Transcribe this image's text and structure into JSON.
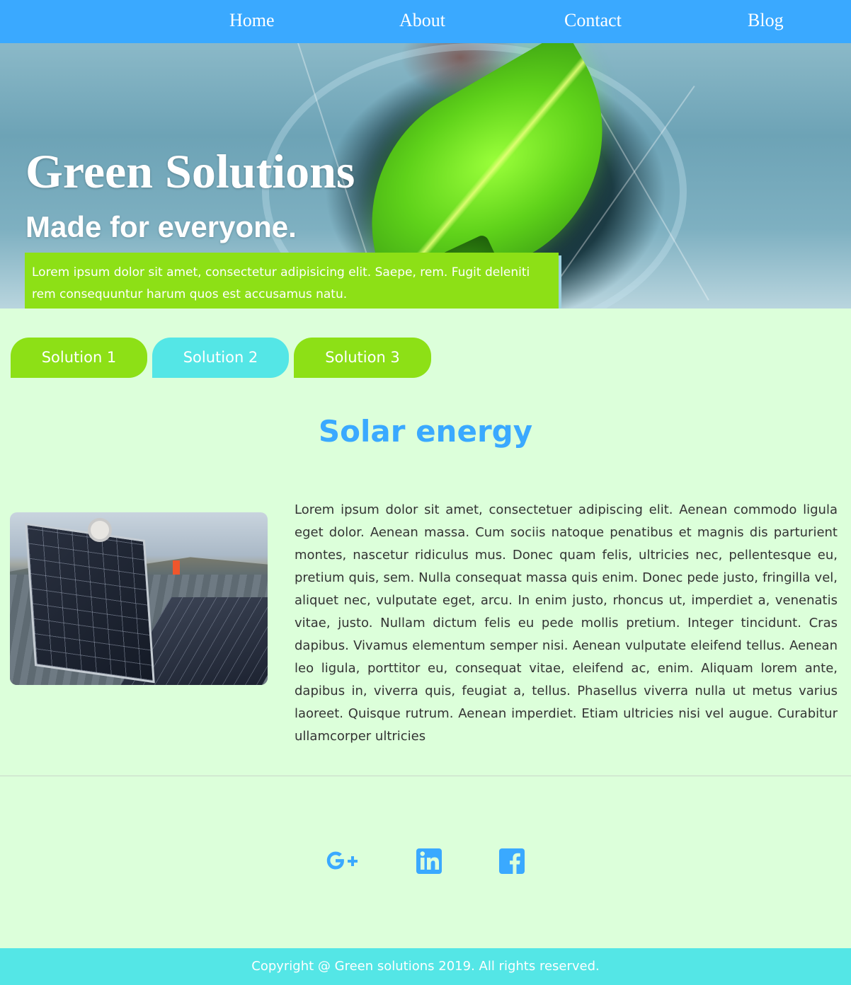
{
  "nav": {
    "items": [
      {
        "label": "Home"
      },
      {
        "label": "About"
      },
      {
        "label": "Contact"
      },
      {
        "label": "Blog"
      }
    ]
  },
  "hero": {
    "title": "Green Solutions",
    "subtitle": "Made for everyone.",
    "blurb": "Lorem ipsum dolor sit amet, consectetur adipisicing elit. Saepe, rem. Fugit deleniti rem consequuntur harum quos est accusamus natu."
  },
  "tabs": [
    {
      "label": "Solution 1",
      "color": "#8de016"
    },
    {
      "label": "Solution 2",
      "color": "#54e6e6"
    },
    {
      "label": "Solution 3",
      "color": "#8de016"
    }
  ],
  "section": {
    "title": "Solar energy",
    "body": "Lorem ipsum dolor sit amet, consectetuer adipiscing elit. Aenean commodo ligula eget dolor. Aenean massa. Cum sociis natoque penatibus et magnis dis parturient montes, nascetur ridiculus mus. Donec quam felis, ultricies nec, pellentesque eu, pretium quis, sem. Nulla consequat massa quis enim. Donec pede justo, fringilla vel, aliquet nec, vulputate eget, arcu. In enim justo, rhoncus ut, imperdiet a, venenatis vitae, justo. Nullam dictum felis eu pede mollis pretium. Integer tincidunt. Cras dapibus. Vivamus elementum semper nisi. Aenean vulputate eleifend tellus. Aenean leo ligula, porttitor eu, consequat vitae, eleifend ac, enim. Aliquam lorem ante, dapibus in, viverra quis, feugiat a, tellus. Phasellus viverra nulla ut metus varius laoreet. Quisque rutrum. Aenean imperdiet. Etiam ultricies nisi vel augue. Curabitur ullamcorper ultricies",
    "image_icon": "solar-panel-photo"
  },
  "social": [
    {
      "icon": "google-plus-icon"
    },
    {
      "icon": "linkedin-icon"
    },
    {
      "icon": "facebook-icon"
    }
  ],
  "footer": {
    "text": "Copyright @ Green solutions 2019. All rights reserved."
  },
  "colors": {
    "nav_bg": "#3aa9ff",
    "page_bg": "#dcffda",
    "accent_green": "#8de016",
    "accent_cyan": "#54e6e6",
    "heading_blue": "#3aa9ff"
  }
}
